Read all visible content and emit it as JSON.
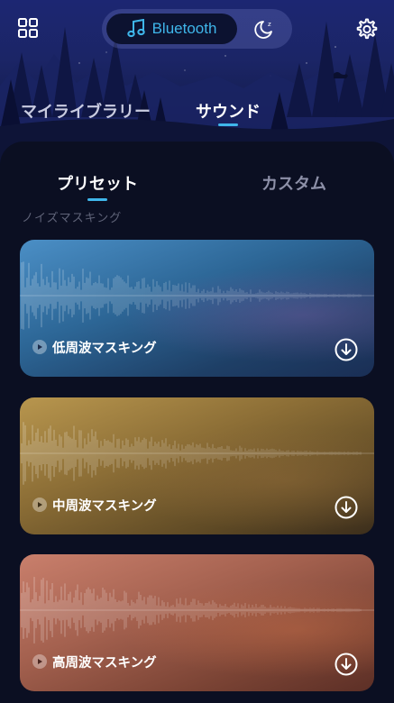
{
  "header": {
    "mode_toggle": {
      "active_label": "Bluetooth",
      "active_icon": "music-note-icon",
      "inactive_icon": "moon-sleep-icon"
    },
    "menu_icon": "grid-icon",
    "settings_icon": "gear-icon"
  },
  "main_tabs": [
    {
      "label": "マイライブラリー",
      "active": false
    },
    {
      "label": "サウンド",
      "active": true
    }
  ],
  "sub_tabs": [
    {
      "label": "プリセット",
      "active": true
    },
    {
      "label": "カスタム",
      "active": false
    }
  ],
  "section": {
    "label": "ノイズマスキング"
  },
  "cards": [
    {
      "title": "低周波マスキング",
      "action_icon": "download-icon",
      "play_icon": "play-icon"
    },
    {
      "title": "中周波マスキング",
      "action_icon": "download-icon",
      "play_icon": "play-icon"
    },
    {
      "title": "高周波マスキング",
      "action_icon": "download-icon",
      "play_icon": "play-icon"
    }
  ],
  "colors": {
    "accent": "#3fb6ea",
    "background": "#0b0f22",
    "card_low": "#2d6797",
    "card_mid": "#8c6e36",
    "card_high": "#a4614f"
  }
}
